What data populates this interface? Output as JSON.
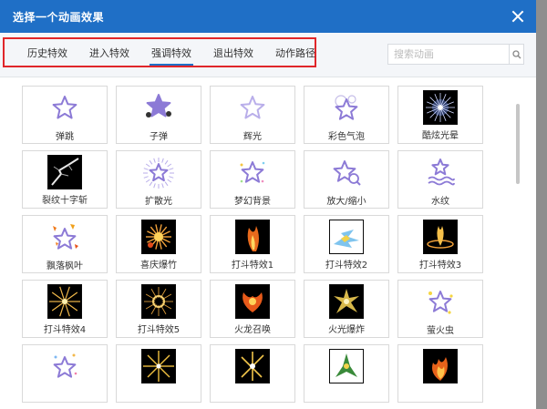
{
  "dialog": {
    "title": "选择一个动画效果"
  },
  "tabs": [
    {
      "label": "历史特效",
      "active": false
    },
    {
      "label": "进入特效",
      "active": false
    },
    {
      "label": "强调特效",
      "active": true
    },
    {
      "label": "退出特效",
      "active": false
    },
    {
      "label": "动作路径",
      "active": false
    }
  ],
  "search": {
    "placeholder": "搜索动画"
  },
  "colors": {
    "accent": "#1f6fc6",
    "highlight": "#e0262a",
    "star": "#8c7ad6"
  },
  "effects": [
    {
      "label": "弹跳",
      "icon": "star-bounce-icon",
      "style": "star"
    },
    {
      "label": "子弹",
      "icon": "star-bullet-icon",
      "style": "star-filled"
    },
    {
      "label": "辉光",
      "icon": "star-glow-icon",
      "style": "star-light"
    },
    {
      "label": "彩色气泡",
      "icon": "star-bubbles-icon",
      "style": "star-bubble"
    },
    {
      "label": "酷炫光晕",
      "icon": "halo-icon",
      "style": "dark-halo"
    },
    {
      "label": "裂纹十字斩",
      "icon": "crack-slash-icon",
      "style": "dark-crack"
    },
    {
      "label": "扩散光",
      "icon": "star-diffuse-icon",
      "style": "star-rays"
    },
    {
      "label": "梦幻背景",
      "icon": "star-dream-icon",
      "style": "star-dream"
    },
    {
      "label": "放大/缩小",
      "icon": "star-zoom-icon",
      "style": "star-zoom"
    },
    {
      "label": "水纹",
      "icon": "star-ripple-icon",
      "style": "star-wave"
    },
    {
      "label": "飘落枫叶",
      "icon": "star-maple-icon",
      "style": "star-leaves"
    },
    {
      "label": "喜庆爆竹",
      "icon": "firecracker-icon",
      "style": "dark-fire"
    },
    {
      "label": "打斗特效1",
      "icon": "fight-effect-1-icon",
      "style": "dark-fight1"
    },
    {
      "label": "打斗特效2",
      "icon": "fight-effect-2-icon",
      "style": "dark-fight2"
    },
    {
      "label": "打斗特效3",
      "icon": "fight-effect-3-icon",
      "style": "dark-fight3"
    },
    {
      "label": "打斗特效4",
      "icon": "fight-effect-4-icon",
      "style": "dark-fight4"
    },
    {
      "label": "打斗特效5",
      "icon": "fight-effect-5-icon",
      "style": "dark-fight5"
    },
    {
      "label": "火龙召唤",
      "icon": "fire-dragon-icon",
      "style": "dark-dragon"
    },
    {
      "label": "火光爆炸",
      "icon": "fire-explosion-icon",
      "style": "dark-explode"
    },
    {
      "label": "萤火虫",
      "icon": "star-firefly-icon",
      "style": "star-firefly"
    },
    {
      "label": "",
      "icon": "star-sparkle-icon",
      "style": "star-sparkle"
    },
    {
      "label": "",
      "icon": "gold-sparkle-1-icon",
      "style": "dark-gold1"
    },
    {
      "label": "",
      "icon": "gold-sparkle-2-icon",
      "style": "dark-gold2"
    },
    {
      "label": "",
      "icon": "green-sparkle-icon",
      "style": "dark-green"
    },
    {
      "label": "",
      "icon": "fire-burst-icon",
      "style": "dark-burst"
    }
  ]
}
